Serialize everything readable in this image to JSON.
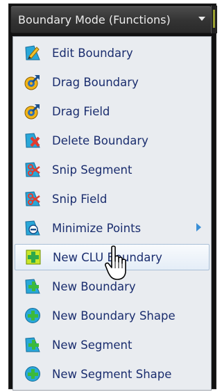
{
  "toolbar": {
    "mode_label": "Boundary Mode (Functions)"
  },
  "menu": {
    "items": [
      {
        "label": "Edit Boundary",
        "icon": "edit-boundary-icon"
      },
      {
        "label": "Drag Boundary",
        "icon": "drag-boundary-icon"
      },
      {
        "label": "Drag Field",
        "icon": "drag-field-icon"
      },
      {
        "label": "Delete Boundary",
        "icon": "delete-boundary-icon"
      },
      {
        "label": "Snip Segment",
        "icon": "snip-segment-icon"
      },
      {
        "label": "Snip Field",
        "icon": "snip-field-icon"
      },
      {
        "label": "Minimize Points",
        "icon": "minimize-points-icon",
        "has_submenu": true
      },
      {
        "label": "New CLU Boundary",
        "icon": "new-clu-boundary-icon",
        "hovered": true
      },
      {
        "label": "New Boundary",
        "icon": "new-boundary-icon"
      },
      {
        "label": "New Boundary Shape",
        "icon": "new-boundary-shape-icon"
      },
      {
        "label": "New Segment",
        "icon": "new-segment-icon"
      },
      {
        "label": "New Segment Shape",
        "icon": "new-segment-shape-icon"
      }
    ]
  },
  "colors": {
    "menu_text": "#1a2d6e",
    "menu_bg": "#e9ecf0",
    "hover_border": "#a9bfd6",
    "toolbar_bg": "#333333"
  }
}
